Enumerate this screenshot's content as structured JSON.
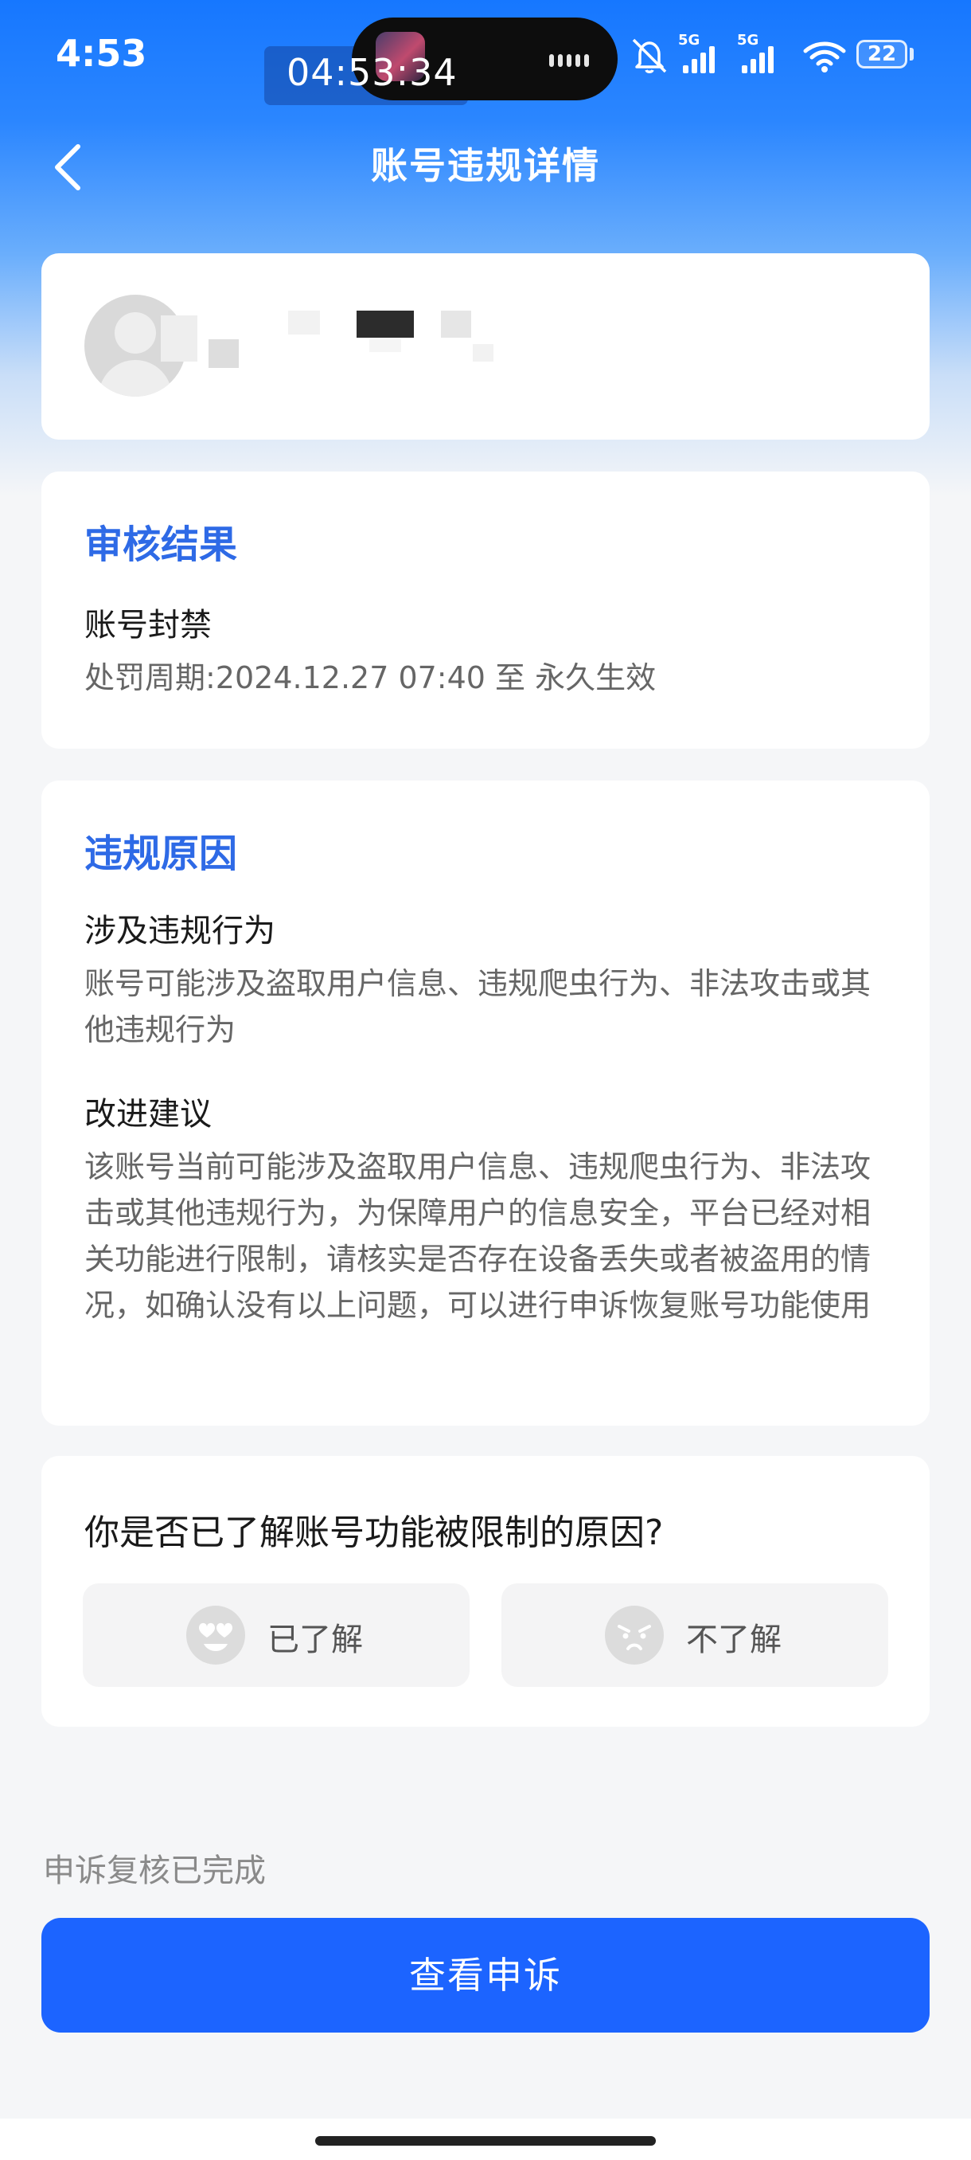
{
  "status_bar": {
    "time": "4:53",
    "timer": "04:53:34",
    "battery": "22",
    "signal_1_label": "5G",
    "signal_2_label": "5G",
    "icons": [
      "mute-icon",
      "signal-5g-icon",
      "signal-5g-icon",
      "wifi-icon",
      "battery-icon"
    ]
  },
  "header": {
    "title": "账号违规详情"
  },
  "review": {
    "section_title": "审核结果",
    "status": "账号封禁",
    "period": "处罚周期:2024.12.27 07:40 至 永久生效"
  },
  "reason": {
    "section_title": "违规原因",
    "behavior_title": "涉及违规行为",
    "behavior_text": "账号可能涉及盗取用户信息、违规爬虫行为、非法攻击或其他违规行为",
    "advice_title": "改进建议",
    "advice_text": "该账号当前可能涉及盗取用户信息、违规爬虫行为、非法攻击或其他违规行为，为保障用户的信息安全，平台已经对相关功能进行限制，请核实是否存在设备丢失或者被盗用的情况，如确认没有以上问题，可以进行申诉恢复账号功能使用"
  },
  "survey": {
    "question": "你是否已了解账号功能被限制的原因?",
    "options": [
      {
        "label": "已了解",
        "icon": "heart-eyes-emoji-icon"
      },
      {
        "label": "不了解",
        "icon": "confused-emoji-icon"
      }
    ]
  },
  "appeal": {
    "status_text": "申诉复核已完成",
    "button_label": "查看申诉"
  },
  "colors": {
    "brand_blue": "#1c64ff",
    "section_title": "#2e6ae6"
  }
}
